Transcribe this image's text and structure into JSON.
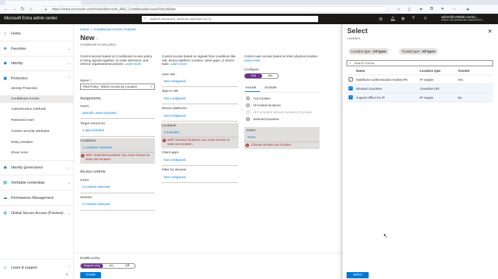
{
  "browser": {
    "url": "https://entra.microsoft.com/#view/Microsoft_AAD_ConditionalAccess/PolicyBlade",
    "lock_icon": "lock-icon"
  },
  "header": {
    "app_title": "Microsoft Entra admin center",
    "search_placeholder": "Search resources, services, and docs (G+/)",
    "user_email": "admin@m365lab.onmicr...",
    "user_org": "M365 LAB (M365LAB.ONMICROS..."
  },
  "sidebar": {
    "items": [
      {
        "label": "Home",
        "icon": "home-icon"
      },
      {
        "label": "Favorites",
        "icon": "star-icon"
      },
      {
        "label": "Identity",
        "icon": "identity-icon"
      },
      {
        "label": "Protection",
        "icon": "lock-icon"
      },
      {
        "label": "Identity governance",
        "icon": "governance-icon"
      },
      {
        "label": "Verifiable credentials",
        "icon": "credential-icon"
      },
      {
        "label": "Permissions Management",
        "icon": "cloud-icon"
      },
      {
        "label": "Global Secure Access (Preview)",
        "icon": "globe-icon"
      },
      {
        "label": "Learn & support",
        "icon": "person-icon"
      }
    ],
    "protection_sub": [
      "Identity Protection",
      "Conditional Access",
      "Authentication methods",
      "Password reset",
      "Custom security attributes",
      "Risky activities",
      "Show more"
    ]
  },
  "breadcrumb": {
    "home": "Home",
    "section": "Conditional Access | Policies"
  },
  "page": {
    "title": "New",
    "subtitle": "Conditional Access policy"
  },
  "col1": {
    "desc": "Control access based on Conditional Access policy to bring signals together, to make decisions, and enforce organizational policies.",
    "learn_more": "Learn more",
    "name_label": "Name *",
    "name_value": "Pilot Policy - Block Access by Location",
    "assignments": "Assignments",
    "users_label": "Users",
    "users_value": "Specific users included",
    "target_label": "Target resources",
    "target_value": "1 app included",
    "conditions_label": "Conditions",
    "conditions_value": "1 condition selected",
    "conditions_error": "With \"Selected locations\" you must choose at least one location.",
    "access_controls": "Access controls",
    "grant_label": "Grant",
    "grant_value": "0 controls selected",
    "session_label": "Session",
    "session_value": "0 controls selected"
  },
  "col2": {
    "desc": "Control access based on signals from conditions like risk, device platform, location, client apps, or device state.",
    "learn_more": "Learn more",
    "user_risk": "User risk",
    "user_risk_value": "Not configured",
    "signin_risk": "Sign-in risk",
    "signin_risk_value": "Not configured",
    "device_platforms": "Device platforms",
    "device_platforms_value": "Not configured",
    "locations": "Locations",
    "locations_value": "0 included",
    "locations_error": "With 'selected locations' you must choose at least one location.",
    "client_apps": "Client apps",
    "client_apps_value": "Not configured",
    "filter_devices": "Filter for devices",
    "filter_devices_value": "Not configured"
  },
  "col3": {
    "desc": "Control user access based on their physical location.",
    "learn_more": "Learn more",
    "configure_label": "Configure",
    "yes": "Yes",
    "no": "No",
    "tab_include": "Include",
    "tab_exclude": "Exclude",
    "options": [
      "Any location",
      "All trusted locations",
      "All Compliant Network locations (Preview)",
      "Selected locations"
    ],
    "select_label": "Select",
    "select_value": "None",
    "select_error": "Choose at least one location"
  },
  "footer": {
    "enable_label": "Enable policy",
    "report_only": "Report-only",
    "on": "On",
    "off": "Off",
    "create": "Create"
  },
  "panel": {
    "title": "Select",
    "subtitle": "Locations",
    "filter1_label": "Location type : ",
    "filter1_value": "All types",
    "filter2_label": "Trusted type : ",
    "filter2_value": "All types",
    "search_placeholder": "Search names",
    "col_name": "Name",
    "col_type": "Location type",
    "col_trusted": "Trusted",
    "rows": [
      {
        "name": "Multifactor authentication trusted IPs",
        "type": "IP ranges",
        "trusted": "Yes",
        "checked": false
      },
      {
        "name": "Blocked Countries",
        "type": "Countries (IP)",
        "trusted": "",
        "checked": true
      },
      {
        "name": "Gujarat Office Fix IP",
        "type": "IP ranges",
        "trusted": "No",
        "checked": true
      }
    ],
    "select_button": "Select"
  }
}
